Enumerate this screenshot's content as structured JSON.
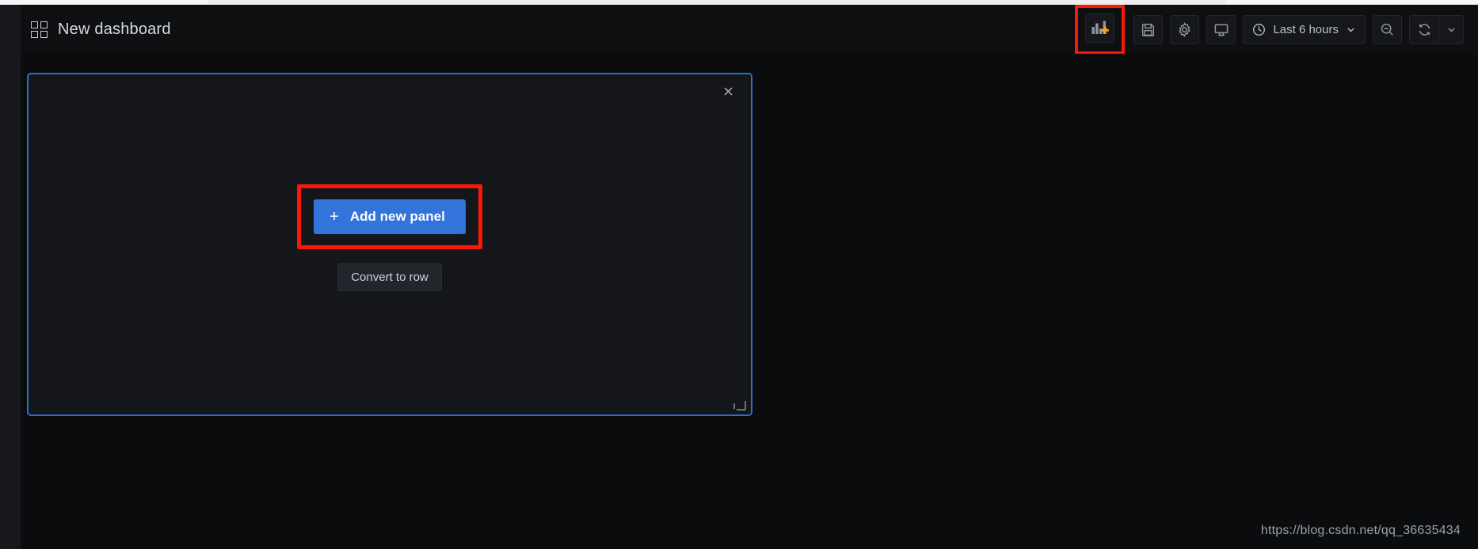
{
  "window": {
    "background_color": "#0b0c0e",
    "panel_background_color": "#141619",
    "accent_blue": "#3274d9",
    "highlight_red": "#fd1706",
    "selection_border": "#2e6dd4"
  },
  "navbar": {
    "grid_icon": "apps-grid-icon",
    "title": "New dashboard",
    "tools": [
      {
        "name": "add-panel-icon",
        "label": "Add panel",
        "highlighted": true
      },
      {
        "name": "save-dashboard-icon",
        "label": "Save dashboard"
      },
      {
        "name": "dashboard-settings-icon",
        "label": "Dashboard settings"
      },
      {
        "name": "tv-kiosk-icon",
        "label": "Cycle view mode"
      }
    ],
    "time_picker": {
      "icon": "clock-icon",
      "value": "Last 6 hours",
      "chevron": "chevron-down-icon"
    },
    "zoom_out": {
      "icon": "zoom-out-icon",
      "label": "Zoom out time range"
    },
    "refresh": {
      "icon": "refresh-icon",
      "label": "Refresh dashboard"
    },
    "refresh_interval": {
      "icon": "chevron-down-icon",
      "label": "Set auto refresh interval"
    }
  },
  "dashboard": {
    "add_panel_widget": {
      "close_icon": "close-icon",
      "add_new_panel": {
        "plus_icon": "plus-icon",
        "label": "Add new panel",
        "highlighted": true
      },
      "convert_to_row": {
        "label": "Convert to row"
      },
      "resize_handle": "resize-handle-icon"
    }
  },
  "watermark": {
    "text": "https://blog.csdn.net/qq_36635434"
  }
}
